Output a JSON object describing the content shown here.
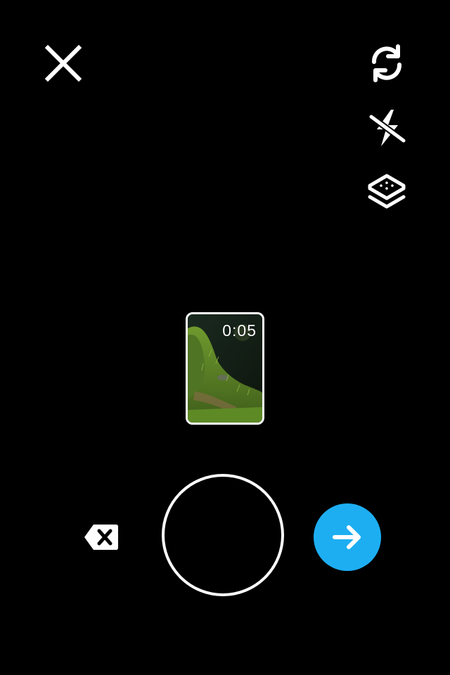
{
  "clip": {
    "duration": "0:05"
  },
  "icons": {
    "close": "close-icon",
    "flip_camera": "flip-camera-icon",
    "flash": "flash-off-icon",
    "layers": "layers-icon",
    "delete": "delete-icon",
    "next": "arrow-right-icon"
  },
  "colors": {
    "background": "#000000",
    "accent": "#1daef2",
    "foreground": "#ffffff"
  }
}
